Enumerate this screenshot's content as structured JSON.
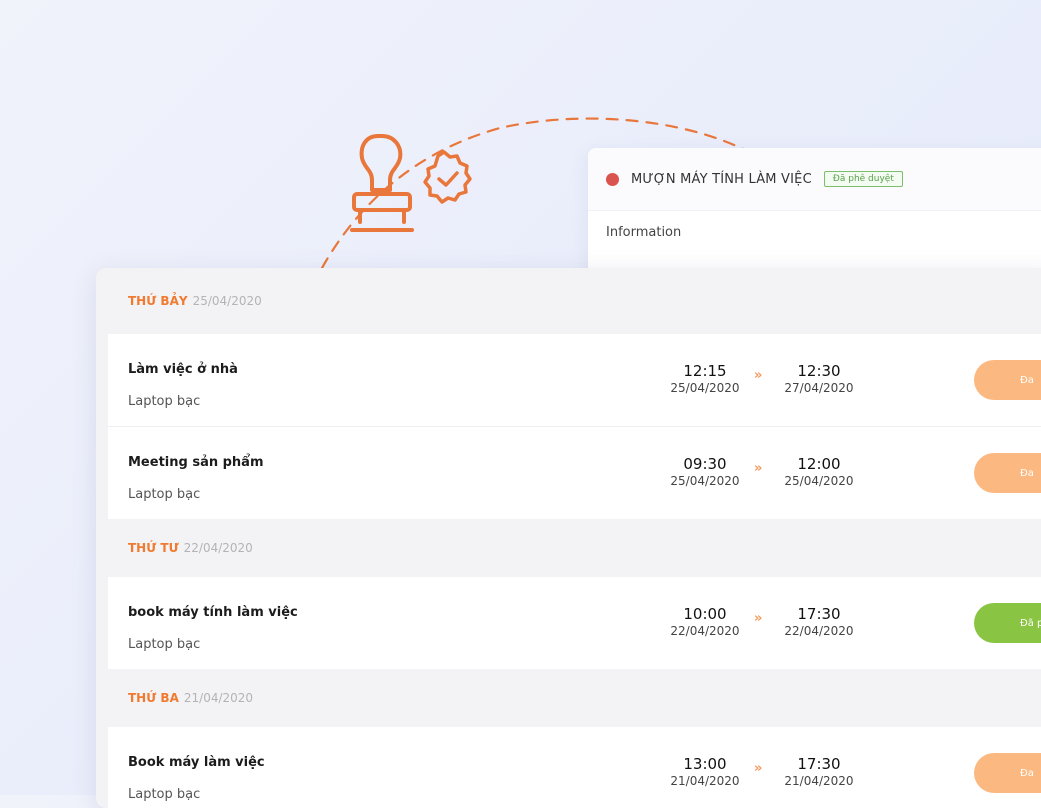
{
  "detail_card": {
    "title": "MƯỢN MÁY TÍNH LÀM VIỆC",
    "status_badge": "Đã phê duyệt",
    "section_heading": "Information",
    "status_dot_color": "#d9534f"
  },
  "illustration": {
    "icons": [
      "stamp-icon",
      "approved-badge-icon"
    ],
    "accent_color": "#e9763a"
  },
  "schedule": {
    "days": [
      {
        "day_name": "THỨ BẢY",
        "date": "25/04/2020",
        "events": [
          {
            "title": "Làm việc ở nhà",
            "device": "Laptop bạc",
            "start_time": "12:15",
            "start_date": "25/04/2020",
            "end_time": "12:30",
            "end_date": "27/04/2020",
            "status": "Đa",
            "status_color": "orange"
          },
          {
            "title": "Meeting sản phẩm",
            "device": "Laptop bạc",
            "start_time": "09:30",
            "start_date": "25/04/2020",
            "end_time": "12:00",
            "end_date": "25/04/2020",
            "status": "Đa",
            "status_color": "orange"
          }
        ]
      },
      {
        "day_name": "THỨ TƯ",
        "date": "22/04/2020",
        "events": [
          {
            "title": "book máy tính làm việc",
            "device": "Laptop bạc",
            "start_time": "10:00",
            "start_date": "22/04/2020",
            "end_time": "17:30",
            "end_date": "22/04/2020",
            "status": "Đã p",
            "status_color": "green"
          }
        ]
      },
      {
        "day_name": "THỨ BA",
        "date": "21/04/2020",
        "events": [
          {
            "title": "Book máy làm việc",
            "device": "Laptop bạc",
            "start_time": "13:00",
            "start_date": "21/04/2020",
            "end_time": "17:30",
            "end_date": "21/04/2020",
            "status": "Đa",
            "status_color": "orange"
          }
        ]
      }
    ],
    "arrow_symbol": "»"
  }
}
